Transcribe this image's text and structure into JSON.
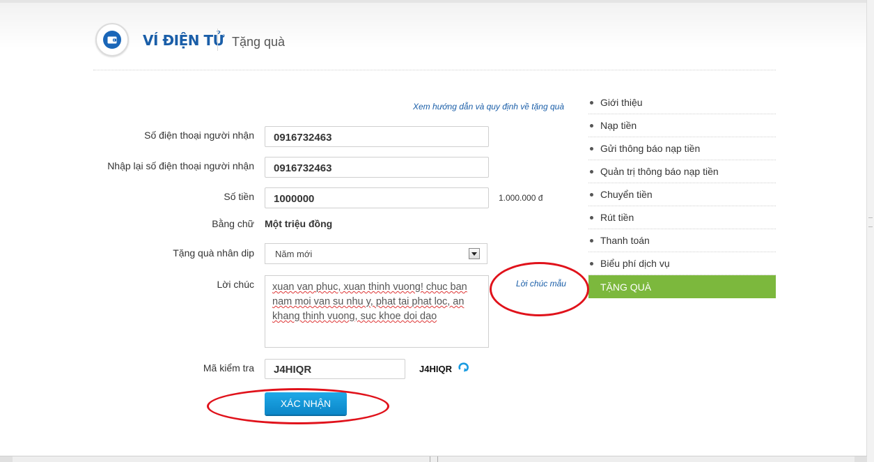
{
  "header": {
    "brand": "VÍ ĐIỆN TỬ",
    "subtitle": "Tặng quà",
    "logo_icon": "wallet-icon"
  },
  "form": {
    "guide_link": "Xem hướng dẫn và quy định về tặng quà",
    "phone_label": "Số điện thoại người nhận",
    "phone_value": "0916732463",
    "phone_confirm_label": "Nhập lại số điện thoại người nhận",
    "phone_confirm_value": "0916732463",
    "amount_label": "Số tiền",
    "amount_value": "1000000",
    "amount_formatted": "1.000.000 đ",
    "words_label": "Bằng chữ",
    "words_value": "Một triệu đồng",
    "occasion_label": "Tặng quà nhân dip",
    "occasion_value": "Năm mới",
    "message_label": "Lời chúc",
    "message_value": "xuan van phuc, xuan thinh vuong! chuc ban nam moi van su nhu y, phat tai phat loc, an khang thinh vuong, suc khoe doi dao",
    "sample_link": "Lời chúc mẫu",
    "captcha_label": "Mã kiểm tra",
    "captcha_value": "J4HIQR",
    "captcha_image_text": "J4HIQR",
    "refresh_icon": "refresh-icon",
    "submit_label": "XÁC NHẬN"
  },
  "sidebar": {
    "items": [
      {
        "label": "Giới thiệu"
      },
      {
        "label": "Nạp tiền"
      },
      {
        "label": "Gửi thông báo nạp tiền"
      },
      {
        "label": "Quản trị thông báo nạp tiền"
      },
      {
        "label": "Chuyển tiền"
      },
      {
        "label": "Rút tiền"
      },
      {
        "label": "Thanh toán"
      },
      {
        "label": "Biểu phí dịch vụ"
      },
      {
        "label": "TẶNG QUÀ",
        "active": true
      }
    ]
  },
  "colors": {
    "brand": "#1a5ea8",
    "active_item": "#7cb83d",
    "button": "#1297d8",
    "annotation": "#e0121b"
  }
}
